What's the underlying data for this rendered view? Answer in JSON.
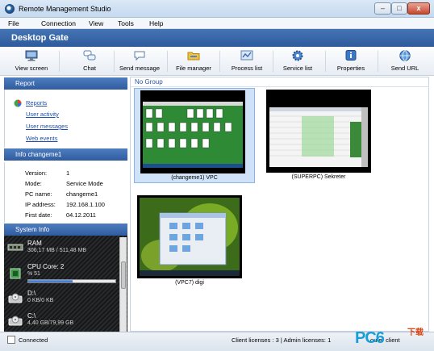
{
  "window": {
    "title": "Remote Management Studio",
    "min_label": "–",
    "max_label": "□",
    "close_label": "x"
  },
  "menu": [
    "File",
    "Connection",
    "View",
    "Tools",
    "Help"
  ],
  "header": {
    "title": "Desktop Gate"
  },
  "toolbar": [
    {
      "label": "View screen",
      "icon": "monitor-icon"
    },
    {
      "label": "Chat",
      "icon": "chat-bubbles-icon"
    },
    {
      "label": "Send message",
      "icon": "speech-bubble-icon"
    },
    {
      "label": "File manager",
      "icon": "folder-icon"
    },
    {
      "label": "Process list",
      "icon": "process-window-icon"
    },
    {
      "label": "Service list",
      "icon": "gear-icon"
    },
    {
      "label": "Properties",
      "icon": "properties-icon"
    },
    {
      "label": "Send URL",
      "icon": "globe-icon"
    }
  ],
  "report": {
    "heading": "Report",
    "links": [
      "Reports",
      "User activity",
      "User messages",
      "Web events"
    ]
  },
  "info": {
    "heading": "Info changeme1",
    "rows": [
      {
        "key": "Version:",
        "value": "1"
      },
      {
        "key": "Mode:",
        "value": "Service Mode"
      },
      {
        "key": "PC name:",
        "value": "changeme1"
      },
      {
        "key": "IP address:",
        "value": "192.168.1.100"
      },
      {
        "key": "First date:",
        "value": "04.12.2011"
      }
    ]
  },
  "system": {
    "heading": "System Info",
    "items": [
      {
        "name": "RAM",
        "detail": "306,17 MB / 511,48 MB",
        "icon": "ram-icon"
      },
      {
        "name": "CPU Core: 2",
        "detail": "% 51",
        "icon": "cpu-icon",
        "progress": 0.51
      },
      {
        "name": "D:\\",
        "detail": "0 KB/0 KB",
        "icon": "disk-icon"
      },
      {
        "name": "C:\\",
        "detail": "4,40 GB/79,99 GB",
        "icon": "disk-icon"
      }
    ]
  },
  "main": {
    "group": "No Group",
    "computers": [
      {
        "caption": "(changeme1) VPC",
        "selected": true
      },
      {
        "caption": "(SUPERPC) Sekreter",
        "selected": false
      },
      {
        "caption": "(VPC7) digi",
        "selected": false
      }
    ]
  },
  "status": {
    "connection": "Connected",
    "licenses": "Client licenses : 3 | Admin licenses: 1",
    "partial": "outer client"
  },
  "watermark": {
    "brand": "PC6",
    "cn": "下载"
  },
  "colors": {
    "header": "#2d5a9a",
    "selection": "#cfe2f8",
    "link": "#1f4fa8",
    "progress": "#2f67c4"
  }
}
